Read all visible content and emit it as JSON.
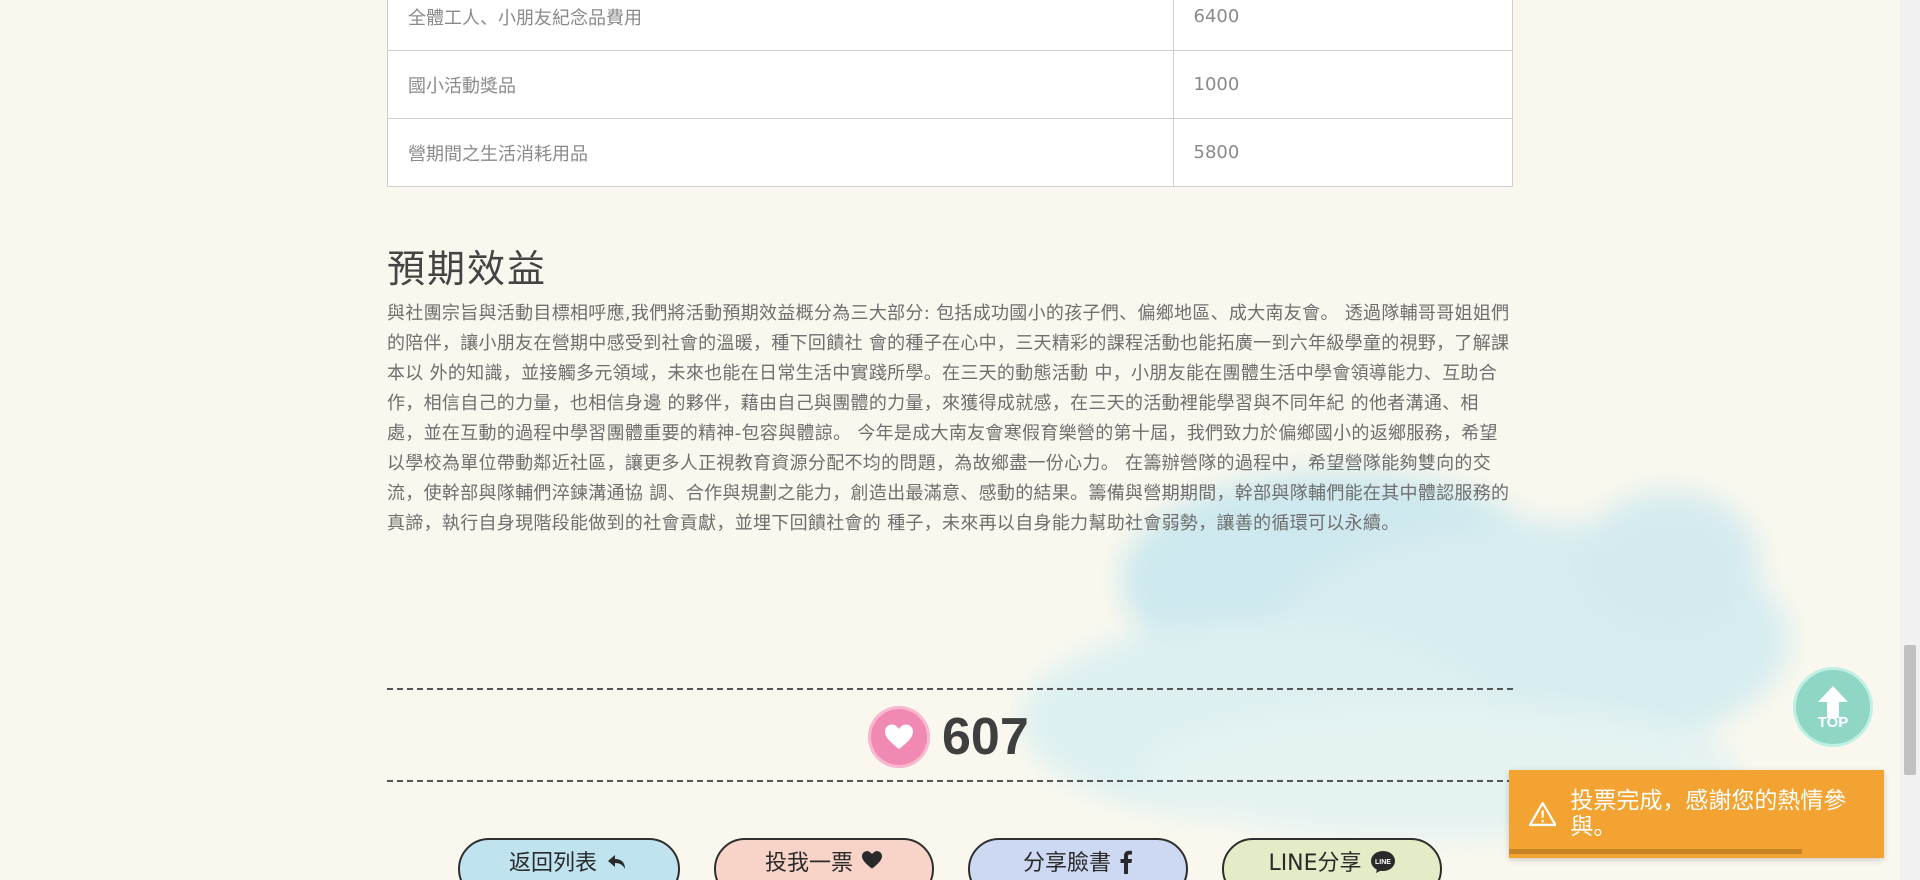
{
  "budget": {
    "rows": [
      {
        "item": "全體工人、小朋友紀念品費用",
        "amount": "6400"
      },
      {
        "item": "國小活動獎品",
        "amount": "1000"
      },
      {
        "item": "營期間之生活消耗用品",
        "amount": "5800"
      }
    ]
  },
  "benefits": {
    "title": "預期效益",
    "body": "與社團宗旨與活動目標相呼應,我們將活動預期效益概分為三大部分: 包括成功國小的孩子們、偏鄉地區、成大南友會。 透過隊輔哥哥姐姐們的陪伴，讓小朋友在營期中感受到社會的溫暖，種下回饋社 會的種子在心中，三天精彩的課程活動也能拓廣一到六年級學童的視野，了解課本以 外的知識，並接觸多元領域，未來也能在日常生活中實踐所學。在三天的動態活動 中，小朋友能在團體生活中學會領導能力、互助合作，相信自己的力量，也相信身邊 的夥伴，藉由自己與團體的力量，來獲得成就感，在三天的活動裡能學習與不同年紀 的他者溝通、相處，並在互動的過程中學習團體重要的精神-包容與體諒。 今年是成大南友會寒假育樂營的第十屆，我們致力於偏鄉國小的返鄉服務，希望以學校為單位帶動鄰近社區，讓更多人正視教育資源分配不均的問題，為故鄉盡一份心力。 在籌辦營隊的過程中，希望營隊能夠雙向的交流，使幹部與隊輔們淬鍊溝通協 調、合作與規劃之能力，創造出最滿意、感動的結果。籌備與營期期間，幹部與隊輔們能在其中體認服務的真諦，執行自身現階段能做到的社會貢獻，並埋下回饋社會的 種子，未來再以自身能力幫助社會弱勢，讓善的循環可以永續。"
  },
  "vote": {
    "count": "607",
    "icon": "heart-icon",
    "color": "#f08ab2"
  },
  "actions": {
    "back_label": "返回列表",
    "vote_label": "投我一票",
    "facebook_label": "分享臉書",
    "line_label": "LINE分享",
    "line_icon_text": "LINE"
  },
  "top_button": {
    "label": "TOP"
  },
  "toast": {
    "message": "投票完成，感謝您的熱情參與。",
    "color": "#f3a331",
    "progress": 0.78
  },
  "colors": {
    "background": "#faf8ee",
    "btn_back": "#bfe3ef",
    "btn_vote": "#f8d4c8",
    "btn_fb": "#cdd9f2",
    "btn_line": "#e3ecc6",
    "top_button": "#8fd6c5"
  }
}
